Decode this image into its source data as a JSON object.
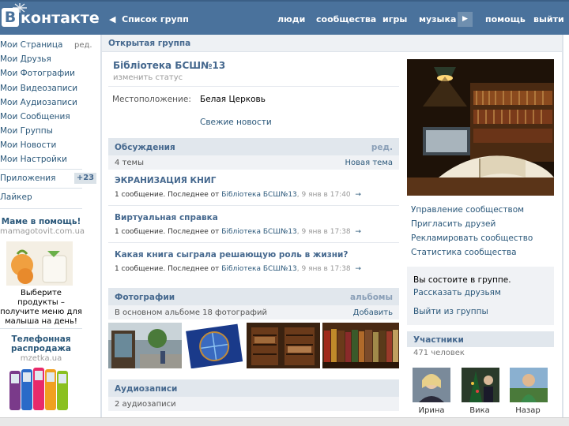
{
  "header": {
    "logo_letter": "B",
    "logo_text": "контакте",
    "back_label": "Список групп",
    "nav": [
      "люди",
      "сообщества",
      "игры",
      "музыка",
      "помощь",
      "выйти"
    ]
  },
  "sidebar": {
    "items": [
      "Мои Страница",
      "Мои Друзья",
      "Мои Фотографии",
      "Мои Видеозаписи",
      "Мои Аудиозаписи",
      "Мои Сообщения",
      "Мои Группы",
      "Мои Новости",
      "Мои Настройки"
    ],
    "edit_label": "ред.",
    "apps_label": "Приложения",
    "apps_badge": "+23",
    "liker_label": "Лайкер"
  },
  "ads": {
    "ad1_title": "Маме в помощь!",
    "ad1_domain": "mamagotovit.com.ua",
    "ad1_text": "Выберите продукты – получите меню для малыша на день!",
    "ad2_title": "Телефонная распродажа",
    "ad2_domain": "mzetka.ua"
  },
  "page": {
    "head": "Открытая группа",
    "group_name": "Бібліотека БСШ№13",
    "status_placeholder": "изменить статус",
    "location_label": "Местоположение:",
    "location_value": "Белая Церковь",
    "news_link": "Свежие новости"
  },
  "discussions": {
    "title": "Обсуждения",
    "edit": "ред.",
    "count": "4 темы",
    "new_topic": "Новая тема",
    "topics": [
      {
        "title": "ЭКРАНИЗАЦИЯ КНИГ",
        "prefix": "1 сообщение. Последнее от",
        "author": "Бібліотека БСШ№13",
        "time": ", 9 янв в 17:40"
      },
      {
        "title": "Виртуальная справка",
        "prefix": "1 сообщение. Последнее от",
        "author": "Бібліотека БСШ№13",
        "time": ", 9 янв в 17:38"
      },
      {
        "title": "Какая книга сыграла решающую роль в жизни?",
        "prefix": "1 сообщение. Последнее от",
        "author": "Бібліотека БСШ№13",
        "time": ", 9 янв в 17:38"
      }
    ]
  },
  "photos": {
    "title": "Фотографии",
    "albums": "альбомы",
    "count": "В основном альбоме 18 фотографий",
    "add": "Добавить"
  },
  "audio": {
    "title": "Аудиозаписи",
    "count": "2 аудиозаписи"
  },
  "right": {
    "links": [
      "Управление сообществом",
      "Пригласить друзей",
      "Рекламировать сообщество",
      "Статистика сообщества"
    ],
    "member_text": "Вы состоите в группе.",
    "tell_friends": "Рассказать друзьям",
    "leave": "Выйти из группы",
    "members_title": "Участники",
    "members_count": "471 человек",
    "members": [
      "Ирина",
      "Вика",
      "Назар"
    ]
  },
  "colors": {
    "header_blue": "#4a729c",
    "link_blue": "#2b587a",
    "section_bg": "#e1e7ed"
  }
}
